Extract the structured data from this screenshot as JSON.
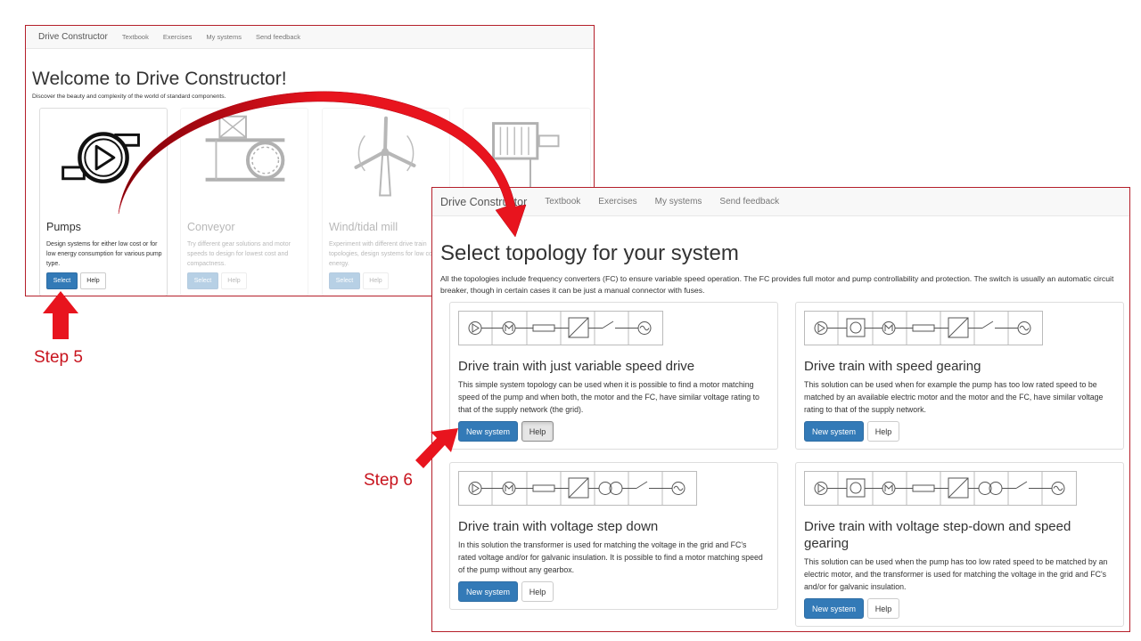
{
  "welcome": {
    "nav": {
      "brand": "Drive Constructor",
      "links": [
        "Textbook",
        "Exercises",
        "My systems",
        "Send feedback"
      ]
    },
    "title": "Welcome to Drive Constructor!",
    "subtitle": "Discover the beauty and complexity of the world of standard components.",
    "select_label": "Select",
    "help_label": "Help",
    "cards": [
      {
        "title": "Pumps",
        "desc": "Design systems for either low cost or for low energy consumption for various pump type."
      },
      {
        "title": "Conveyor",
        "desc": "Try different gear solutions and motor speeds to design for lowest cost and compactness."
      },
      {
        "title": "Wind/tidal mill",
        "desc": "Experiment with different drive train topologies, design systems for low cost of energy."
      }
    ]
  },
  "topology": {
    "nav": {
      "brand": "Drive Constructor",
      "links": [
        "Textbook",
        "Exercises",
        "My systems",
        "Send feedback"
      ]
    },
    "title": "Select topology for your system",
    "intro": "All the topologies include frequency converters (FC) to ensure variable speed operation. The FC provides full motor and pump controllability and protection. The switch is usually an automatic circuit breaker, though in certain cases it can be just a manual connector with fuses.",
    "new_system_label": "New system",
    "help_label": "Help",
    "cards": [
      {
        "title": "Drive train with just variable speed drive",
        "desc": "This simple system topology can be used when it is possible to find a motor matching speed of the pump and when both, the motor and the FC, have similar voltage rating to that of the supply network (the grid)."
      },
      {
        "title": "Drive train with speed gearing",
        "desc": "This solution can be used when for example the pump has too low rated speed to be matched by an available electric motor and the motor and the FC, have similar voltage rating to that of the supply network."
      },
      {
        "title": "Drive train with voltage step down",
        "desc": "In this solution the transformer is used for matching the voltage in the grid and FC's rated voltage and/or for galvanic insulation. It is possible to find a motor matching speed of the pump without any gearbox."
      },
      {
        "title": "Drive train with voltage step-down and speed gearing",
        "desc": "This solution can be used when the pump has too low rated speed to be matched by an electric motor, and the transformer is used for matching the voltage in the grid and FC's and/or for galvanic insulation."
      }
    ]
  },
  "annotations": {
    "step5": "Step 5",
    "step6": "Step 6"
  },
  "colors": {
    "accent": "#337ab7",
    "frame": "#b51f2a",
    "arrow": "#e8141e"
  }
}
